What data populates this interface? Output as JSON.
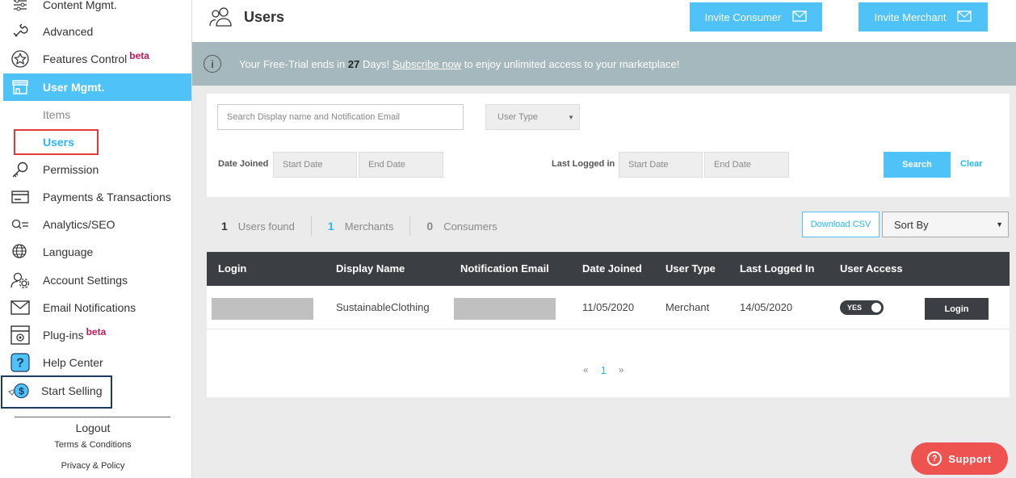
{
  "sidebar": {
    "items": [
      {
        "label": "Content Mgmt.",
        "icon": "sliders-icon"
      },
      {
        "label": "Advanced",
        "icon": "wrench-icon"
      },
      {
        "label": "Features Control",
        "icon": "star-icon",
        "beta": "beta"
      },
      {
        "label": "User Mgmt.",
        "icon": "store-icon"
      },
      {
        "label": "Permission",
        "icon": "key-icon"
      },
      {
        "label": "Payments & Transactions",
        "icon": "credit-card-icon"
      },
      {
        "label": "Analytics/SEO",
        "icon": "search-list-icon"
      },
      {
        "label": "Language",
        "icon": "globe-icon"
      },
      {
        "label": "Account Settings",
        "icon": "user-gear-icon"
      },
      {
        "label": "Email Notifications",
        "icon": "envelope-icon"
      },
      {
        "label": "Plug-ins",
        "icon": "plugin-icon",
        "beta": "beta"
      },
      {
        "label": "Help Center",
        "icon": "help-icon"
      },
      {
        "label": "Start Selling",
        "icon": "dollar-icon"
      }
    ],
    "sub_items": [
      "Items",
      "Users"
    ],
    "logout": "Logout",
    "terms": "Terms & Conditions",
    "privacy": "Privacy & Policy"
  },
  "header": {
    "title": "Users",
    "invite_consumer": "Invite Consumer",
    "invite_merchant": "Invite Merchant"
  },
  "banner": {
    "text_before": "Your Free-Trial ends in ",
    "days": "27",
    "text_days": " Days! ",
    "link": "Subscribe now",
    "text_after": " to enjoy unlimited access to your marketplace!"
  },
  "filters": {
    "search_placeholder": "Search Display name and Notification Email",
    "user_type": "User Type",
    "date_joined_label": "Date Joined",
    "last_logged_label": "Last Logged in",
    "start_date": "Start Date",
    "end_date": "End Date",
    "search": "Search",
    "clear": "Clear"
  },
  "counts": {
    "users_num": "1",
    "users_label": "Users found",
    "merchants_num": "1",
    "merchants_label": "Merchants",
    "consumers_num": "0",
    "consumers_label": "Consumers"
  },
  "download_csv": "Download CSV",
  "sort_by": "Sort By",
  "table": {
    "headers": [
      "Login",
      "Display Name",
      "Notification Email",
      "Date Joined",
      "User Type",
      "Last Logged In",
      "User Access"
    ],
    "rows": [
      {
        "display_name": "SustainableClothing",
        "date_joined": "11/05/2020",
        "user_type": "Merchant",
        "last_logged_in": "14/05/2020",
        "access": "YES",
        "login": "Login"
      }
    ]
  },
  "pagination": {
    "prev": "«",
    "current": "1",
    "next": "»"
  },
  "support": "Support",
  "colors": {
    "accent": "#4fc3f7",
    "dark": "#3b3e43",
    "banner": "#a5b8bd",
    "support": "#ef5350",
    "beta": "#c2185b"
  }
}
